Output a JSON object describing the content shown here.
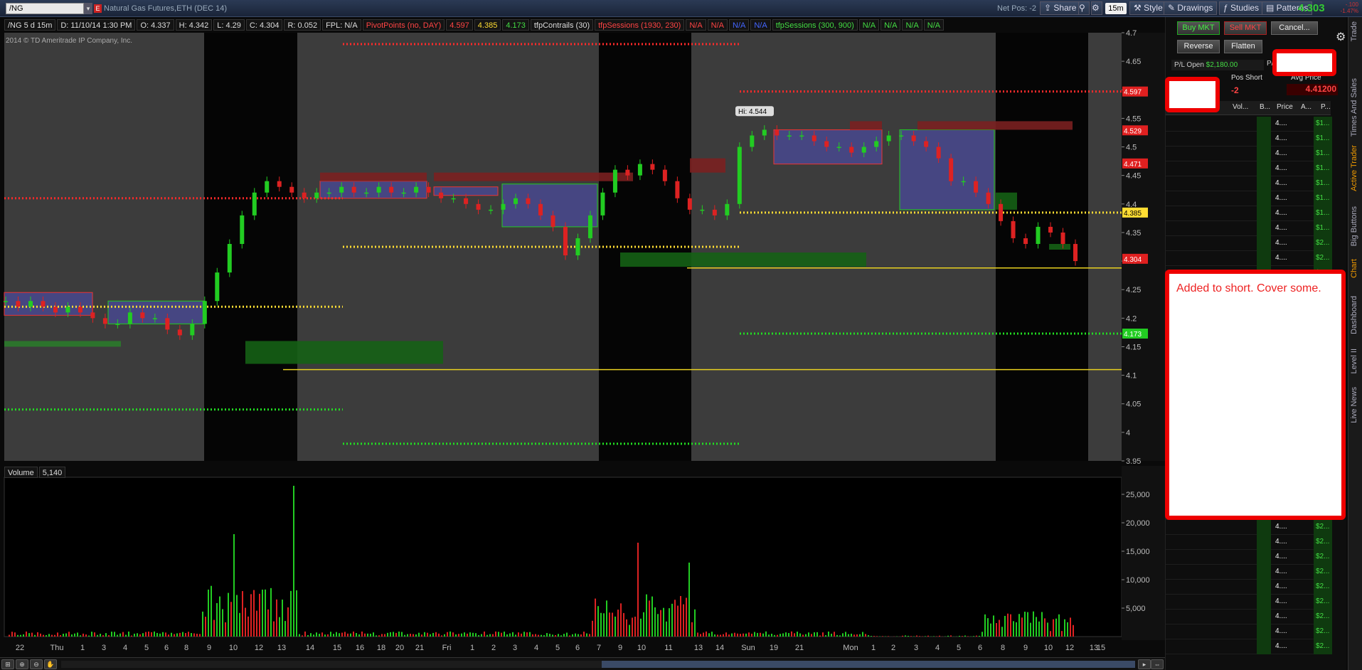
{
  "topbar": {
    "symbol": "/NG",
    "symbol_flag": "E",
    "description": "Natural Gas Futures,ETH (DEC 14)",
    "net_pos": "Net Pos: -2",
    "share": "Share",
    "timeframe": "15m",
    "style": "Style",
    "drawings": "Drawings",
    "studies": "Studies",
    "patterns": "Patterns",
    "last_price": "4.303",
    "last_change_a": "-.100",
    "last_change_b": "-1.47%"
  },
  "info_bar": [
    {
      "text": "/NG 5 d 15m",
      "color": "#dddddd"
    },
    {
      "text": "D: 11/10/14 1:30 PM",
      "color": "#dddddd"
    },
    {
      "text": "O: 4.337",
      "color": "#dddddd"
    },
    {
      "text": "H: 4.342",
      "color": "#dddddd"
    },
    {
      "text": "L: 4.29",
      "color": "#dddddd"
    },
    {
      "text": "C: 4.304",
      "color": "#dddddd"
    },
    {
      "text": "R: 0.052",
      "color": "#dddddd"
    },
    {
      "text": "FPL: N/A",
      "color": "#dddddd"
    },
    {
      "text": "PivotPoints (no, DAY)",
      "color": "#ff4444"
    },
    {
      "text": "4.597",
      "color": "#ff4444"
    },
    {
      "text": "4.385",
      "color": "#ffdd33"
    },
    {
      "text": "4.173",
      "color": "#44dd44"
    },
    {
      "text": "tfpContrails (30)",
      "color": "#dddddd"
    },
    {
      "text": "tfpSessions (1930, 230)",
      "color": "#ff4444"
    },
    {
      "text": "N/A",
      "color": "#ff4444"
    },
    {
      "text": "N/A",
      "color": "#ff4444"
    },
    {
      "text": "N/A",
      "color": "#4466ff"
    },
    {
      "text": "N/A",
      "color": "#4466ff"
    },
    {
      "text": "tfpSessions (300, 900)",
      "color": "#44dd44"
    },
    {
      "text": "N/A",
      "color": "#44dd44"
    },
    {
      "text": "N/A",
      "color": "#44dd44"
    },
    {
      "text": "N/A",
      "color": "#44dd44"
    },
    {
      "text": "N/A",
      "color": "#44dd44"
    }
  ],
  "copyright": "2014 © TD Ameritrade IP Company, Inc.",
  "volume": {
    "label": "Volume",
    "value": "5,140"
  },
  "chart_data": {
    "type": "candlestick",
    "price_axis": {
      "ticks": [
        4.7,
        4.65,
        4.6,
        4.55,
        4.5,
        4.45,
        4.4,
        4.35,
        4.3,
        4.25,
        4.2,
        4.15,
        4.1,
        4.05,
        4.0,
        3.95
      ],
      "labels": [
        "4.7",
        "4.65",
        "4.6",
        "4.55",
        "4.5",
        "4.45",
        "4.4",
        "4.35",
        "4.3",
        "4.25",
        "4.2",
        "4.15",
        "4.1",
        "4.05",
        "4",
        "3.95"
      ]
    },
    "price_badges": [
      {
        "value": 4.597,
        "label": "4.597",
        "color": "#e02020"
      },
      {
        "value": 4.529,
        "label": "4.529",
        "color": "#e02020"
      },
      {
        "value": 4.471,
        "label": "4.471",
        "color": "#e02020"
      },
      {
        "value": 4.385,
        "label": "4.385",
        "color": "#ffdd33"
      },
      {
        "value": 4.304,
        "label": "4.304",
        "color": "#e02020"
      },
      {
        "value": 4.173,
        "label": "4.173",
        "color": "#22cc22"
      }
    ],
    "high_label": {
      "text": "Hi: 4.544",
      "value": 4.544
    },
    "volume_axis": {
      "ticks": [
        25000,
        20000,
        15000,
        10000,
        5000
      ],
      "labels": [
        "25,000",
        "20,000",
        "15,000",
        "10,000",
        "5,000"
      ]
    },
    "x_labels": [
      "22",
      "Thu",
      "1",
      "3",
      "4",
      "5",
      "6",
      "8",
      "9",
      "10",
      "12",
      "13",
      "14",
      "15",
      "16",
      "18",
      "20",
      "21",
      "Fri",
      "1",
      "2",
      "3",
      "4",
      "5",
      "6",
      "7",
      "9",
      "10",
      "11",
      "13",
      "14",
      "Sun",
      "19",
      "21",
      "Mon",
      "1",
      "2",
      "3",
      "4",
      "5",
      "6",
      "8",
      "9",
      "10",
      "12",
      "13",
      "15"
    ],
    "price_series": [
      4.23,
      4.22,
      4.23,
      4.22,
      4.21,
      4.22,
      4.21,
      4.2,
      4.19,
      4.19,
      4.21,
      4.2,
      4.2,
      4.18,
      4.17,
      4.19,
      4.23,
      4.28,
      4.33,
      4.38,
      4.42,
      4.44,
      4.43,
      4.42,
      4.41,
      4.42,
      4.42,
      4.43,
      4.42,
      4.42,
      4.43,
      4.42,
      4.42,
      4.43,
      4.42,
      4.41,
      4.41,
      4.4,
      4.39,
      4.39,
      4.4,
      4.41,
      4.4,
      4.38,
      4.36,
      4.31,
      4.34,
      4.38,
      4.42,
      4.46,
      4.45,
      4.47,
      4.46,
      4.44,
      4.41,
      4.39,
      4.39,
      4.38,
      4.4,
      4.5,
      4.52,
      4.53,
      4.52,
      4.52,
      4.52,
      4.51,
      4.5,
      4.5,
      4.49,
      4.5,
      4.51,
      4.52,
      4.52,
      4.51,
      4.5,
      4.48,
      4.44,
      4.44,
      4.42,
      4.4,
      4.37,
      4.34,
      4.33,
      4.36,
      4.35,
      4.33,
      4.3
    ]
  },
  "trade_panel": {
    "buy_mkt": "Buy MKT",
    "sell_mkt": "Sell MKT",
    "cancel": "Cancel...",
    "reverse": "Reverse",
    "flatten": "Flatten",
    "pl_open_label": "P/L Open",
    "pl_open_value": "$2,180.00",
    "pl_day_label": "P/L",
    "pos_short_label": "Pos Short",
    "pos_short_value": "-2",
    "avg_price_label": "Avg Price",
    "avg_price_value": "4.41200",
    "ladder_headers": {
      "volume": "Vol...",
      "buy": "B...",
      "price": "Price",
      "ask": "A...",
      "pl": "P..."
    },
    "ladder_rows": [
      {
        "price": "4....",
        "pl": "$1..."
      },
      {
        "price": "4....",
        "pl": "$1..."
      },
      {
        "price": "4....",
        "pl": "$1..."
      },
      {
        "price": "4....",
        "pl": "$1..."
      },
      {
        "price": "4....",
        "pl": "$1..."
      },
      {
        "price": "4....",
        "pl": "$1..."
      },
      {
        "price": "4....",
        "pl": "$1..."
      },
      {
        "price": "4....",
        "pl": "$1..."
      },
      {
        "price": "4....",
        "pl": "$2..."
      },
      {
        "price": "4....",
        "pl": "$2..."
      },
      {
        "price": "4....",
        "pl": "$2..."
      },
      {
        "price": "4....",
        "pl": "$2..."
      },
      {
        "price": "4....",
        "pl": "$2..."
      },
      {
        "price": "4....",
        "pl": "$2..."
      },
      {
        "price": "4....",
        "pl": "$2..."
      },
      {
        "price": "4....",
        "pl": "$2..."
      },
      {
        "price": "4....",
        "pl": "$2..."
      },
      {
        "price": "4....",
        "pl": "$2..."
      },
      {
        "price": "4....",
        "pl": "$2..."
      },
      {
        "price": "4....",
        "pl": "$2..."
      },
      {
        "price": "4....",
        "pl": "$2..."
      },
      {
        "price": "4....",
        "pl": "$2..."
      },
      {
        "price": "4....",
        "pl": "$2..."
      },
      {
        "price": "4....",
        "pl": "$2..."
      },
      {
        "price": "4....",
        "pl": "$2..."
      },
      {
        "price": "4....",
        "pl": "$2..."
      },
      {
        "price": "4....",
        "pl": "$2..."
      },
      {
        "price": "4....",
        "pl": "$2..."
      },
      {
        "price": "4....",
        "pl": "$2..."
      },
      {
        "price": "4....",
        "pl": "$2..."
      },
      {
        "price": "4....",
        "pl": "$2..."
      },
      {
        "price": "4....",
        "pl": "$2..."
      },
      {
        "price": "4....",
        "pl": "$2..."
      },
      {
        "price": "4....",
        "pl": "$2..."
      },
      {
        "price": "4....",
        "pl": "$2..."
      },
      {
        "price": "4....",
        "pl": "$2..."
      }
    ]
  },
  "side_tabs": [
    "Trade",
    "Times And Sales",
    "Active Trader",
    "Big Buttons",
    "Chart",
    "Dashboard",
    "Level II",
    "Live News"
  ],
  "annotation": {
    "note": "Added to short. Cover some."
  },
  "colors": {
    "up": "#22cc22",
    "down": "#dd2222",
    "pivot_r": "#ff2222",
    "pivot_p": "#ffdd33",
    "pivot_s": "#22dd22",
    "yellow_line": "#e8d020"
  }
}
